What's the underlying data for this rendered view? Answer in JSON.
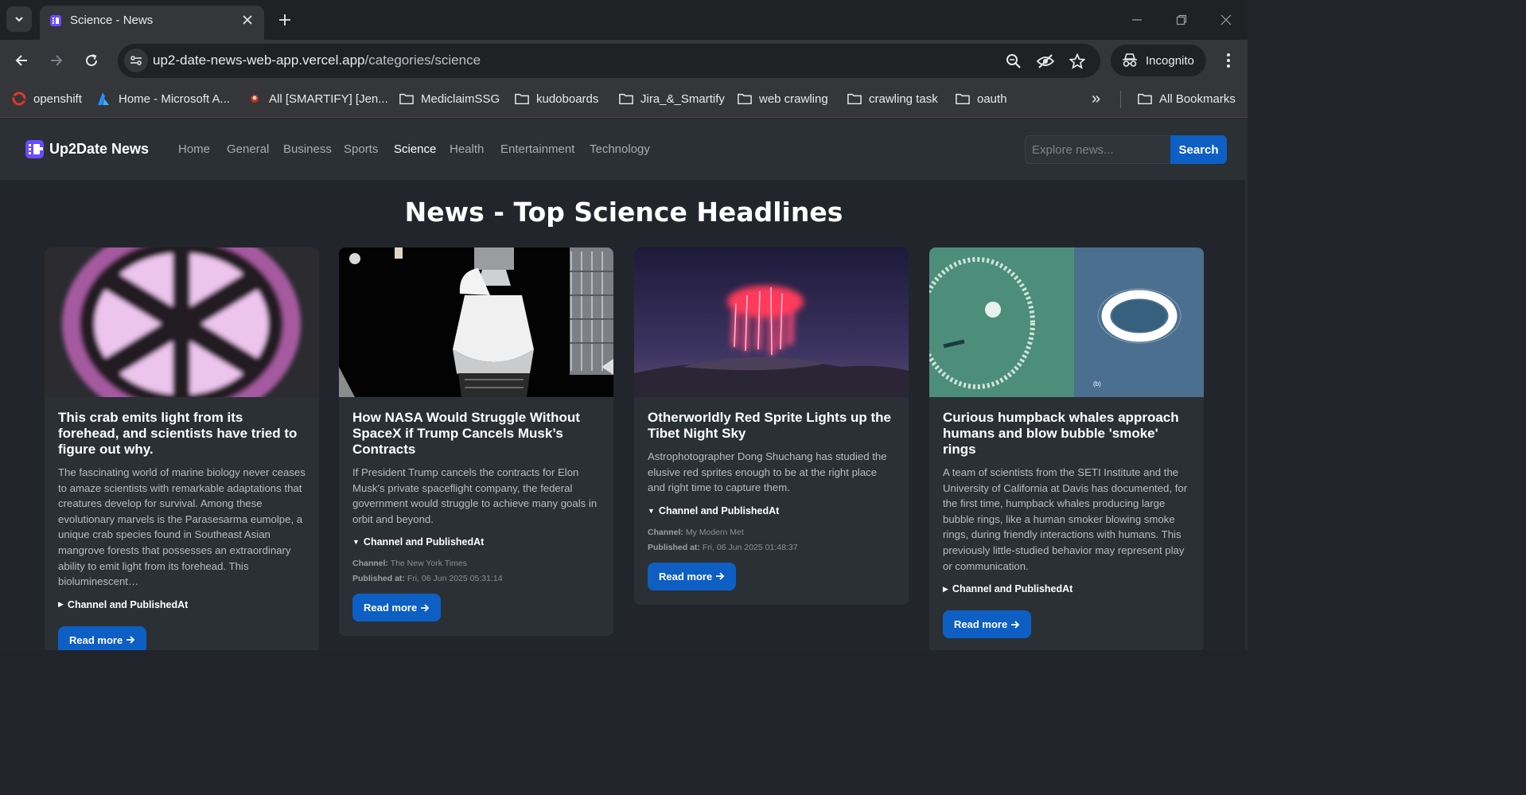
{
  "browser": {
    "tab_title": "Science - News",
    "url_host": "up2-date-news-web-app.vercel.app",
    "url_path": "/categories/science",
    "incognito_label": "Incognito",
    "bookmarks": [
      {
        "label": "openshift",
        "icon": "openshift-icon"
      },
      {
        "label": "Home - Microsoft A...",
        "icon": "azure-icon"
      },
      {
        "label": "All [SMARTIFY] [Jen...",
        "icon": "jenkins-icon"
      },
      {
        "label": "MediclaimSSG",
        "icon": "folder-icon"
      },
      {
        "label": "kudoboards",
        "icon": "folder-icon"
      },
      {
        "label": "Jira_&_Smartify",
        "icon": "folder-icon"
      },
      {
        "label": "web crawling",
        "icon": "folder-icon"
      },
      {
        "label": "crawling task",
        "icon": "folder-icon"
      },
      {
        "label": "oauth",
        "icon": "folder-icon"
      }
    ],
    "all_bookmarks_label": "All Bookmarks",
    "overflow_label": "»"
  },
  "site": {
    "brand": "Up2Date News",
    "nav": [
      "Home",
      "General",
      "Business",
      "Sports",
      "Science",
      "Health",
      "Entertainment",
      "Technology"
    ],
    "active_nav": "Science",
    "search_placeholder": "Explore news...",
    "search_label": "Search",
    "heading": "News - Top Science Headlines"
  },
  "colors": {
    "accent": "#0d5fc4",
    "page_bg": "#22262c",
    "card_bg": "#2b3035"
  },
  "articles": [
    {
      "title": "This crab emits light from its forehead, and scientists have tried to figure out why.",
      "description": "The fascinating world of marine biology never ceases to amaze scientists with remarkable adaptations that creatures develop for survival. Among these evolutionary marvels is the Parasesarma eumolpe, a unique crab species found in Southeast Asian mangrove forests that possesses an extraordinary ability to emit light from its forehead. This bioluminescent…",
      "details_label": "Channel and PublishedAt",
      "expanded": false,
      "read_more": "Read more",
      "image": "pink-x-logo-placeholder"
    },
    {
      "title": "How NASA Would Struggle Without SpaceX if Trump Cancels Musk’s Contracts",
      "description": "If President Trump cancels the contracts for Elon Musk's private spaceflight company, the federal government would struggle to achieve many goals in orbit and beyond.",
      "details_label": "Channel and PublishedAt",
      "expanded": true,
      "channel_label": "Channel:",
      "channel": "The New York Times",
      "published_label": "Published at:",
      "published": "Fri, 06 Jun 2025 05:31:14",
      "read_more": "Read more",
      "image": "spacex-dragon-capsule-photo"
    },
    {
      "title": "Otherworldly Red Sprite Lights up the Tibet Night Sky",
      "description": "Astrophotographer Dong Shuchang has studied the elusive red sprites enough to be at the right place and right time to capture them.",
      "details_label": "Channel and PublishedAt",
      "expanded": true,
      "channel_label": "Channel:",
      "channel": "My Modern Met",
      "published_label": "Published at:",
      "published": "Fri, 06 Jun 2025 01:48:37",
      "read_more": "Read more",
      "image": "red-sprite-night-sky-photo"
    },
    {
      "title": "Curious humpback whales approach humans and blow bubble 'smoke' rings",
      "description": "A team of scientists from the SETI Institute and the University of California at Davis has documented, for the first time, humpback whales producing large bubble rings, like a human smoker blowing smoke rings, during friendly interactions with humans. This previously little-studied behavior may represent play or communication.",
      "details_label": "Channel and PublishedAt",
      "expanded": false,
      "read_more": "Read more",
      "image": "whale-bubble-rings-photo",
      "image_caption": "(b)"
    }
  ]
}
